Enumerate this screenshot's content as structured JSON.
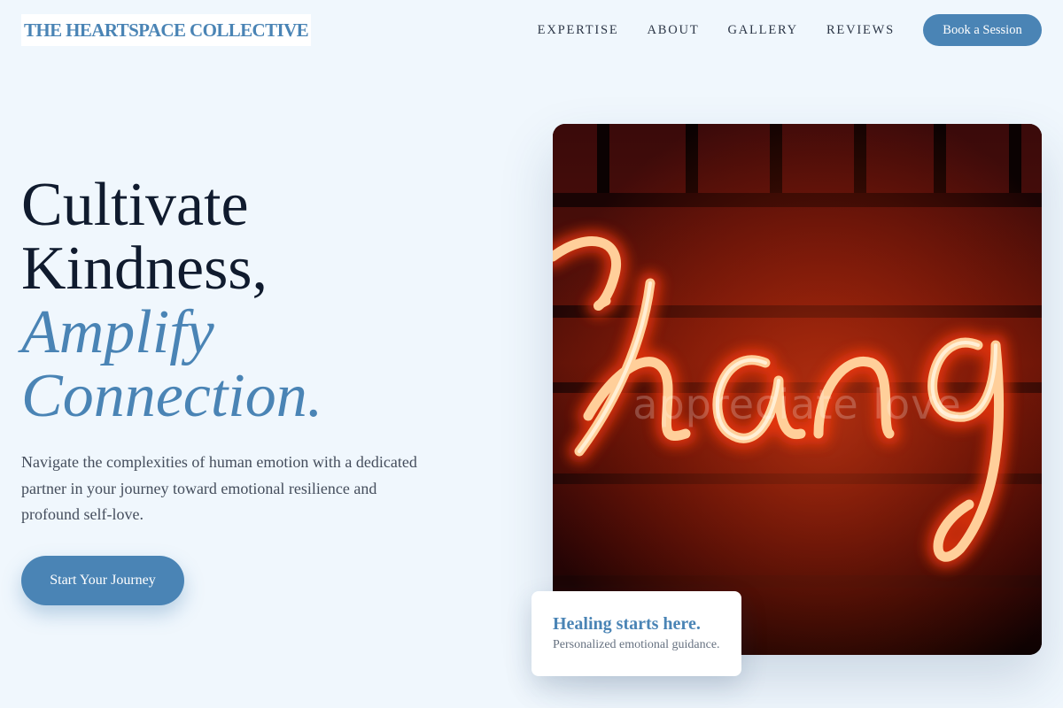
{
  "brand": {
    "name": "THE HEARTSPACE COLLECTIVE"
  },
  "nav": {
    "links": [
      "EXPERTISE",
      "ABOUT",
      "GALLERY",
      "REVIEWS"
    ],
    "cta_label": "Book a Session"
  },
  "hero": {
    "headline_line1": "Cultivate",
    "headline_line2": "Kindness,",
    "headline_accent_line1": "Amplify",
    "headline_accent_line2": "Connection.",
    "subtext": "Navigate the complexities of human emotion with a dedicated partner in your journey toward emotional resilience and profound self-love.",
    "cta_label": "Start Your Journey",
    "image_watermark": "appreciate love"
  },
  "card": {
    "title": "Healing starts here.",
    "subtitle": "Personalized emotional guidance."
  },
  "colors": {
    "page_background": "#f0f7fd",
    "accent": "#4a84b5",
    "heading": "#101b2e",
    "body_text": "#444d5c",
    "neon": "#ff5a2a"
  },
  "icons": {
    "hero_image": "neon-sign-image"
  }
}
